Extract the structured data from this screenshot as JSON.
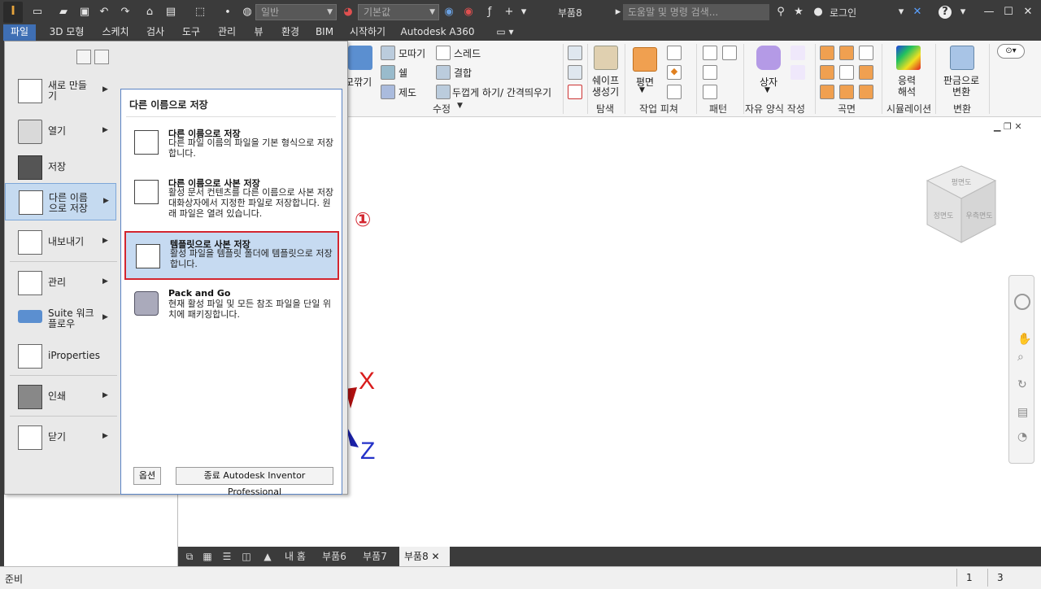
{
  "titlebar": {
    "style_dropdown": "일반",
    "material_dropdown": "기본값",
    "doc_title": "부품8",
    "search_placeholder": "도움말 및 명령 검색...",
    "login": "로그인",
    "app_logo": "I",
    "help_icon": "?"
  },
  "tabs": [
    "파일",
    "3D 모형",
    "스케치",
    "검사",
    "도구",
    "관리",
    "뷰",
    "환경",
    "BIM",
    "시작하기",
    "Autodesk A360"
  ],
  "ribbon": {
    "modify": {
      "chamfer_partial": "모깎기",
      "chamfer": "모따기",
      "shell": "쉘",
      "draft": "제도",
      "thread": "스레드",
      "combine": "결합",
      "thicken": "두껍게 하기/ 간격띄우기",
      "label": "수정"
    },
    "explore": {
      "shape_gen": "쉐이프\n생성기",
      "label": "탐색"
    },
    "work_features": {
      "plane": "평면",
      "label": "작업 피쳐"
    },
    "pattern": {
      "label": "패턴"
    },
    "freeform": {
      "box": "상자",
      "label": "자유 양식 작성"
    },
    "surface": {
      "label": "곡면"
    },
    "simulation": {
      "stress": "응력\n해석",
      "label": "시뮬레이션"
    },
    "convert": {
      "sheetmetal": "판금으로\n변환",
      "label": "변환"
    }
  },
  "appmenu": {
    "items": [
      {
        "label": "새로 만들\n기"
      },
      {
        "label": "열기"
      },
      {
        "label": "저장"
      },
      {
        "label": "다른 이름\n으로 저장"
      },
      {
        "label": "내보내기"
      },
      {
        "label": "관리"
      },
      {
        "label": "Suite 워크\n플로우"
      },
      {
        "label": "iProperties"
      },
      {
        "label": "인쇄"
      },
      {
        "label": "닫기"
      }
    ],
    "submenu": {
      "title": "다른 이름으로 저장",
      "entries": [
        {
          "title": "다른 이름으로 저장",
          "desc": "다른 파일 이름의 파일을 기본 형식으로 저장합니다."
        },
        {
          "title": "다른 이름으로 사본 저장",
          "desc": "활성 문서 컨텐츠를 다른 이름으로 사본 저장 대화상자에서 지정한 파일로 저장합니다. 원래 파일은 열려 있습니다."
        },
        {
          "title": "템플릿으로 사본 저장",
          "desc": "활성 파일을 템플릿 폴더에 템플릿으로 저장합니다."
        },
        {
          "title": "Pack and Go",
          "desc": "현재 활성 파일 및 모든 참조 파일을 단일 위치에 패키징합니다."
        }
      ]
    },
    "options_button": "옵션",
    "exit_button": "종료 Autodesk Inventor Professional"
  },
  "callout": "①",
  "viewport": {
    "axis_x": "X",
    "axis_z": "Z",
    "viewcube_faces": [
      "평면도",
      "정면도",
      "우측면도"
    ]
  },
  "doc_tabs": [
    "내 홈",
    "부품6",
    "부품7",
    "부품8"
  ],
  "statusbar": {
    "text": "준비",
    "num1": "1",
    "num2": "3"
  },
  "colors": {
    "accent": "#3f6fb4",
    "highlight": "#d3262f",
    "selected_bg": "#c6daf1"
  }
}
